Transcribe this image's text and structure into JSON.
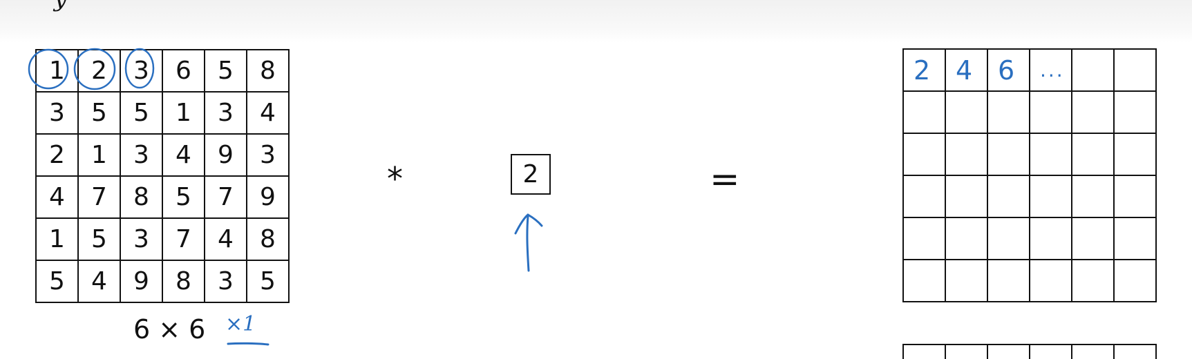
{
  "header": {
    "title_fragment": "y"
  },
  "input_matrix": {
    "rows": [
      [
        "1",
        "2",
        "3",
        "6",
        "5",
        "8"
      ],
      [
        "3",
        "5",
        "5",
        "1",
        "3",
        "4"
      ],
      [
        "2",
        "1",
        "3",
        "4",
        "9",
        "3"
      ],
      [
        "4",
        "7",
        "8",
        "5",
        "7",
        "9"
      ],
      [
        "1",
        "5",
        "3",
        "7",
        "4",
        "8"
      ],
      [
        "5",
        "4",
        "9",
        "8",
        "3",
        "5"
      ]
    ],
    "dims_label": "6 × 6",
    "handwritten_note": "×1"
  },
  "operator": "*",
  "filter": {
    "value": "2"
  },
  "equals": "=",
  "output_matrix": {
    "first_row": [
      "2",
      "4",
      "6",
      "...",
      "",
      ""
    ],
    "rows": 6,
    "cols": 6
  },
  "colors": {
    "ink": "#2a6fc0",
    "line": "#111111"
  }
}
